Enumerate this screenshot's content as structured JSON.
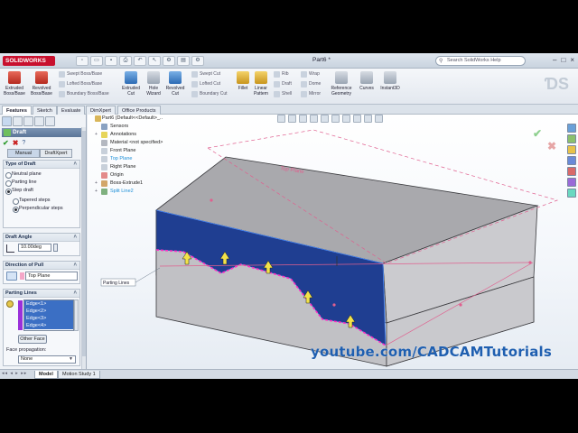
{
  "app": {
    "logo": "SOLIDWORKS",
    "doc_title": "Part6 *",
    "help_search_placeholder": "Search SolidWorks Help",
    "window_buttons": [
      "–",
      "□",
      "×"
    ]
  },
  "ribbon": {
    "big_buttons": [
      {
        "label": "Extruded Boss/Base",
        "icon": "extruded-boss-icon",
        "color": "#d24a3c"
      },
      {
        "label": "Revolved Boss/Base",
        "icon": "revolved-boss-icon",
        "color": "#d24a3c"
      },
      {
        "label": "Extruded Cut",
        "icon": "extruded-cut-icon",
        "color": "#3c7cc4"
      },
      {
        "label": "Hole Wizard",
        "icon": "hole-wizard-icon",
        "color": "#888888"
      },
      {
        "label": "Revolved Cut",
        "icon": "revolved-cut-icon",
        "color": "#3c7cc4"
      },
      {
        "label": "Fillet",
        "icon": "fillet-icon",
        "color": "#c8951d"
      },
      {
        "label": "Linear Pattern",
        "icon": "linear-pattern-icon",
        "color": "#c8951d"
      },
      {
        "label": "Reference Geometry",
        "icon": "reference-geometry-icon",
        "color": "#888888"
      },
      {
        "label": "Curves",
        "icon": "curves-icon",
        "color": "#888888"
      },
      {
        "label": "Instant3D",
        "icon": "instant3d-icon",
        "color": "#888888"
      }
    ],
    "small_buttons": [
      "Swept Boss/Base",
      "Lofted Boss/Base",
      "Boundary Boss/Base",
      "Swept Cut",
      "Lofted Cut",
      "Boundary Cut",
      "Rib",
      "Draft",
      "Shell",
      "Wrap",
      "Dome",
      "Mirror"
    ]
  },
  "command_tabs": [
    "Features",
    "Sketch",
    "Evaluate",
    "DimXpert",
    "Office Products"
  ],
  "property_manager": {
    "title": "Draft",
    "modes": [
      "Manual",
      "DraftXpert"
    ],
    "type_of_draft": {
      "title": "Type of Draft",
      "options": [
        "Neutral plane",
        "Parting line",
        "Step draft"
      ],
      "selected": "Step draft",
      "sub_options": [
        "Tapered steps",
        "Perpendicular steps"
      ],
      "sub_selected": "Perpendicular steps"
    },
    "draft_angle": {
      "title": "Draft Angle",
      "value": "10.00deg"
    },
    "direction_of_pull": {
      "title": "Direction of Pull",
      "value": "Top Plane"
    },
    "parting_lines": {
      "title": "Parting Lines",
      "edges": [
        "Edge<1>",
        "Edge<2>",
        "Edge<3>",
        "Edge<4>"
      ],
      "other_face_label": "Other Face",
      "face_propagation_label": "Face propagation:",
      "face_propagation_value": "None"
    }
  },
  "feature_tree": [
    {
      "label": "Part6  (Default<<Default>_..",
      "icon": "part-icon",
      "level": 0
    },
    {
      "label": "Sensors",
      "icon": "sensors-icon",
      "level": 1
    },
    {
      "label": "Annotations",
      "icon": "annotations-icon",
      "level": 1
    },
    {
      "label": "Material <not specified>",
      "icon": "material-icon",
      "level": 1
    },
    {
      "label": "Front Plane",
      "icon": "plane-icon",
      "level": 1
    },
    {
      "label": "Top Plane",
      "icon": "plane-icon",
      "level": 1,
      "highlight": true
    },
    {
      "label": "Right Plane",
      "icon": "plane-icon",
      "level": 1
    },
    {
      "label": "Origin",
      "icon": "origin-icon",
      "level": 1
    },
    {
      "label": "Boss-Extrude1",
      "icon": "extrude-icon",
      "level": 1
    },
    {
      "label": "Split Line2",
      "icon": "split-line-icon",
      "level": 1,
      "highlight": true
    }
  ],
  "viewport": {
    "top_plane_label": "Top Plane",
    "parting_lines_callout": "Parting Lines",
    "colors": {
      "top_face": "#a7a7ab",
      "front_face": "#c5c5c9",
      "side_face": "#cfcfd3",
      "selected_face": "#1e3d8f",
      "parting_line": "#ff2ec4",
      "plane": "#e0608f"
    }
  },
  "bottom_tabs": [
    "Model",
    "Motion Study 1"
  ],
  "watermark": "youtube.com/CADCAMTutorials"
}
